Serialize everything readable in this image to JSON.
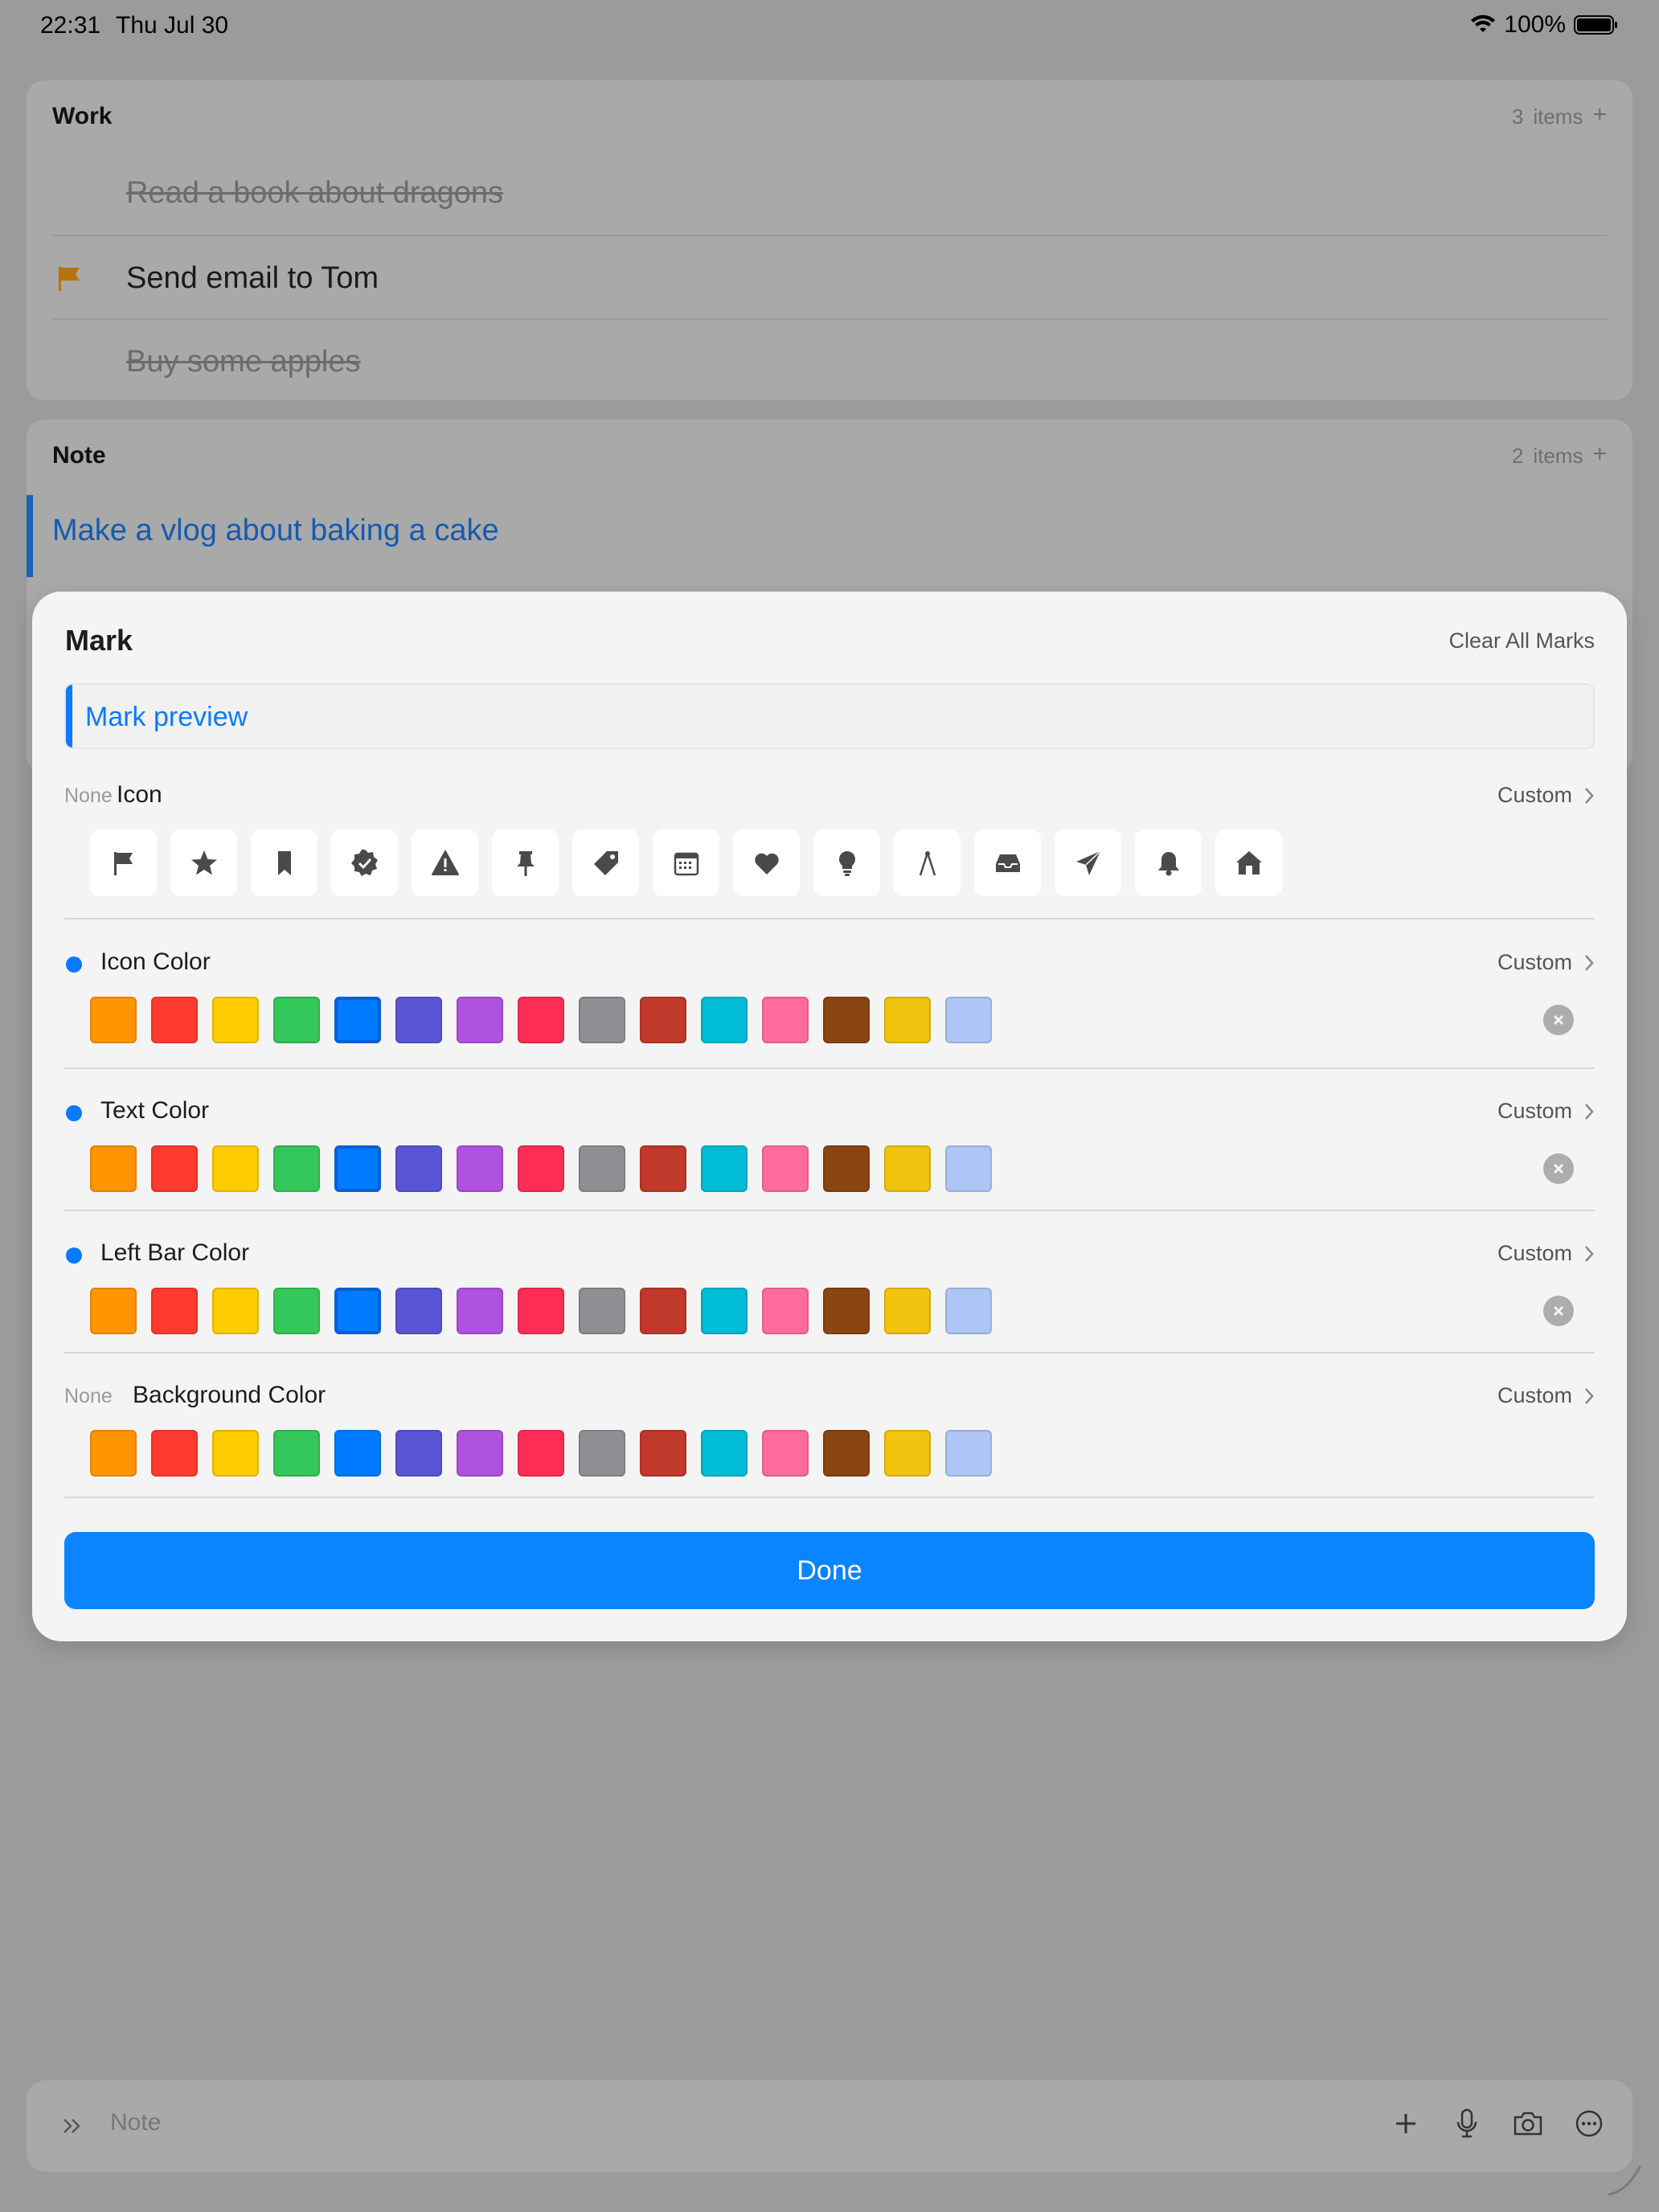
{
  "status_bar": {
    "time": "22:31",
    "date": "Thu Jul 30",
    "battery": "100%"
  },
  "background": {
    "work": {
      "title": "Work",
      "count_number": "3",
      "count_label": "items",
      "add_glyph": "+",
      "items": [
        {
          "text": "Read a book about dragons",
          "state": "completed"
        },
        {
          "text": "Send email to Tom",
          "state": "flagged",
          "flag_color": "#b8720f"
        },
        {
          "text": "Buy some apples",
          "state": "completed"
        }
      ]
    },
    "note": {
      "title": "Note",
      "count_number": "2",
      "count_label": "items",
      "add_glyph": "+",
      "items": [
        {
          "text": "Make a vlog about baking a cake",
          "bar_color": "#1a61b8"
        }
      ]
    }
  },
  "sheet": {
    "title": "Mark",
    "clear_all": "Clear All Marks",
    "preview": {
      "text": "Mark preview",
      "accent": "#0a7aff"
    },
    "icon_section": {
      "none_label": "None",
      "label": "Icon",
      "custom_label": "Custom",
      "icons": [
        "flag-icon",
        "star-icon",
        "bookmark-icon",
        "verified-badge-icon",
        "warning-icon",
        "pin-icon",
        "tag-icon",
        "calendar-icon",
        "heart-icon",
        "lightbulb-icon",
        "compass-icon",
        "inbox-tray-icon",
        "paper-plane-icon",
        "bell-icon",
        "house-icon"
      ]
    },
    "palette": [
      "#ff9500",
      "#ff3b30",
      "#ffcc00",
      "#34c759",
      "#007aff",
      "#5856d6",
      "#af52de",
      "#ff2d55",
      "#8e8e93",
      "#c0392b",
      "#00bcd4",
      "#ff6b9d",
      "#8b4513",
      "#f1c40f",
      "#adc6f5"
    ],
    "color_sections": [
      {
        "key": "icon_color",
        "label": "Icon Color",
        "state": "set",
        "custom_label": "Custom",
        "selected_index": 4,
        "clearable": true
      },
      {
        "key": "text_color",
        "label": "Text Color",
        "state": "set",
        "custom_label": "Custom",
        "selected_index": 4,
        "clearable": true
      },
      {
        "key": "left_bar_color",
        "label": "Left Bar Color",
        "state": "set",
        "custom_label": "Custom",
        "selected_index": 4,
        "clearable": true
      },
      {
        "key": "background_color",
        "label": "Background Color",
        "state": "none",
        "none_label": "None",
        "custom_label": "Custom",
        "selected_index": null,
        "clearable": false
      }
    ],
    "done_label": "Done"
  },
  "input_bar": {
    "placeholder": "Note"
  },
  "colors": {
    "accent": "#0a84ff",
    "overlay_bg": "#9b9b9b"
  }
}
